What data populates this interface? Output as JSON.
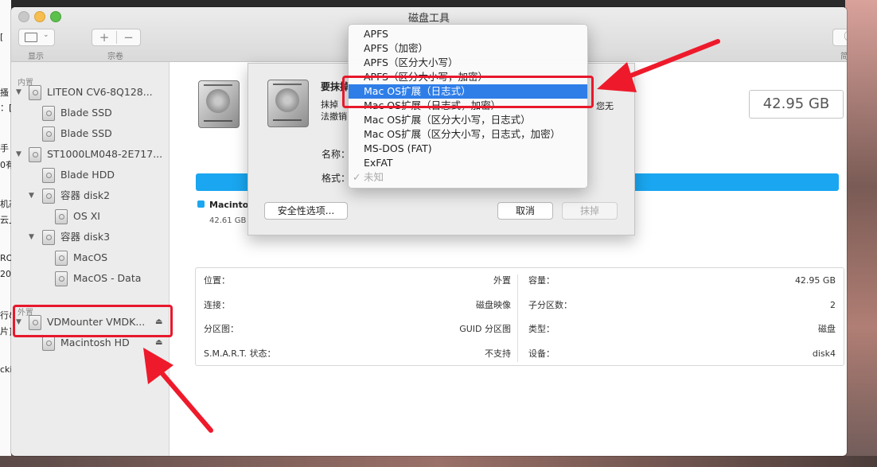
{
  "window": {
    "title": "磁盘工具"
  },
  "toolbar": {
    "display_label": "显示",
    "volume_label": "宗卷",
    "add": "+",
    "remove": "−",
    "info_icon": "ⓘ",
    "info_label": "简介"
  },
  "sidebar": {
    "internal_label": "内置",
    "external_label": "外置",
    "items": [
      {
        "label": "LITEON CV6-8Q128..."
      },
      {
        "label": "Blade SSD"
      },
      {
        "label": "Blade SSD"
      },
      {
        "label": "ST1000LM048-2E717..."
      },
      {
        "label": "Blade HDD"
      },
      {
        "label": "容器 disk2"
      },
      {
        "label": "OS XI"
      },
      {
        "label": "容器 disk3"
      },
      {
        "label": "MacOS"
      },
      {
        "label": "MacOS - Data"
      },
      {
        "label": "VDMounter VMDK..."
      },
      {
        "label": "Macintosh HD"
      }
    ],
    "eject_icon": "⏏"
  },
  "main": {
    "capacity": "42.95 GB",
    "legend_name": "Macintos",
    "legend_size": "42.61 GB",
    "info": {
      "left": [
        {
          "k": "位置：",
          "v": "外置"
        },
        {
          "k": "连接：",
          "v": "磁盘映像"
        },
        {
          "k": "分区图：",
          "v": "GUID 分区图"
        },
        {
          "k": "S.M.A.R.T. 状态：",
          "v": "不支持"
        }
      ],
      "right": [
        {
          "k": "容量：",
          "v": "42.95 GB"
        },
        {
          "k": "子分区数：",
          "v": "2"
        },
        {
          "k": "类型：",
          "v": "磁盘"
        },
        {
          "k": "设备：",
          "v": "disk4"
        }
      ]
    }
  },
  "sheet": {
    "heading": "要抹掉",
    "desc1": "抹掉",
    "desc2": "法撤销",
    "desc_tail": "您无",
    "name_label": "名称：",
    "format_label": "格式：",
    "security_button": "安全性选项...",
    "cancel_button": "取消",
    "erase_button": "抹掉"
  },
  "menu": {
    "items": [
      {
        "label": "APFS"
      },
      {
        "label": "APFS（加密）"
      },
      {
        "label": "APFS（区分大小写）"
      },
      {
        "label": "APFS（区分大小写，加密）"
      },
      {
        "label": "Mac OS扩展（日志式）"
      },
      {
        "label": "Mac OS扩展（日志式，加密）"
      },
      {
        "label": "Mac OS扩展（区分大小写，日志式）"
      },
      {
        "label": "Mac OS扩展（区分大小写，日志式，加密）"
      },
      {
        "label": "MS-DOS (FAT)"
      },
      {
        "label": "ExFAT"
      },
      {
        "label": "未知"
      }
    ],
    "checkmark": "✓"
  },
  "desktop": {
    "fragments": [
      "[",
      "搔",
      "：[",
      "手",
      "0有",
      "机态",
      "云上",
      "RO",
      "20F",
      "行&",
      "片]",
      "cki"
    ]
  },
  "colors": {
    "accent": "#2f7ee8",
    "bar": "#1aa6f0",
    "highlight": "#e8182c"
  }
}
